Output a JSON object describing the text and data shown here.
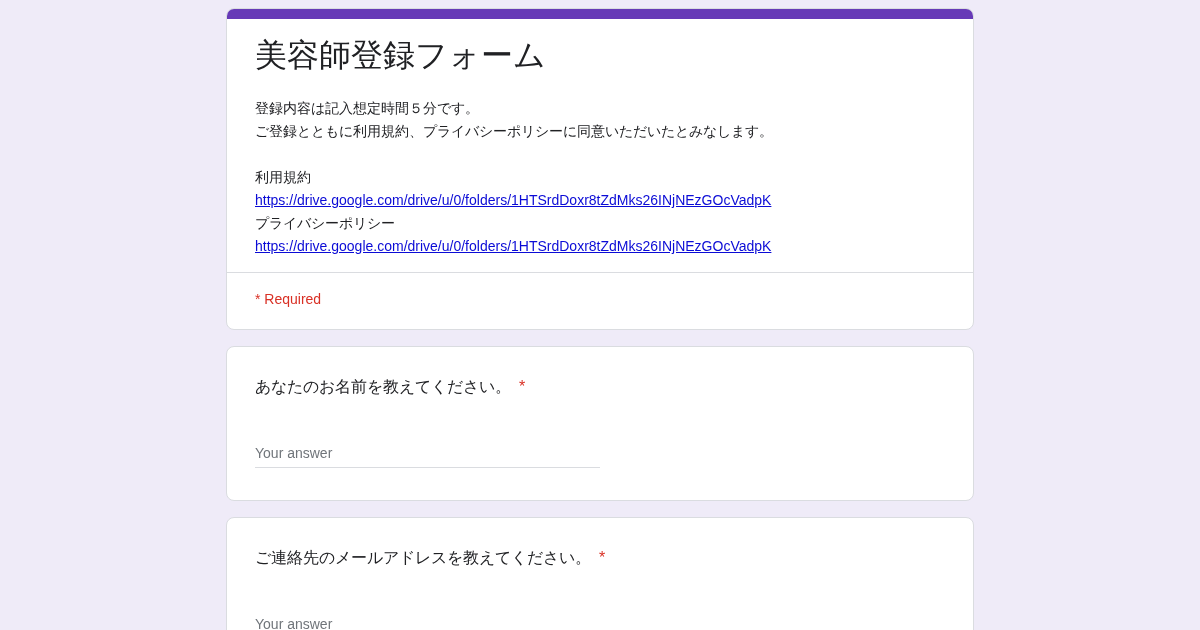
{
  "form": {
    "title": "美容師登録フォーム",
    "description": [
      "登録内容は記入想定時間５分です。",
      "ご登録とともに利用規約、プライバシーポリシーに同意いただいたとみなします。"
    ],
    "links": [
      {
        "label": "利用規約",
        "url": "https://drive.google.com/drive/u/0/folders/1HTSrdDoxr8tZdMks26INjNEzGOcVadpK"
      },
      {
        "label": "プライバシーポリシー",
        "url": "https://drive.google.com/drive/u/0/folders/1HTSrdDoxr8tZdMks26INjNEzGOcVadpK"
      }
    ],
    "required_note": "* Required",
    "required_mark": "*"
  },
  "questions": [
    {
      "text": "あなたのお名前を教えてください。",
      "required": true,
      "placeholder": "Your answer"
    },
    {
      "text": "ご連絡先のメールアドレスを教えてください。",
      "required": true,
      "placeholder": "Your answer"
    }
  ]
}
